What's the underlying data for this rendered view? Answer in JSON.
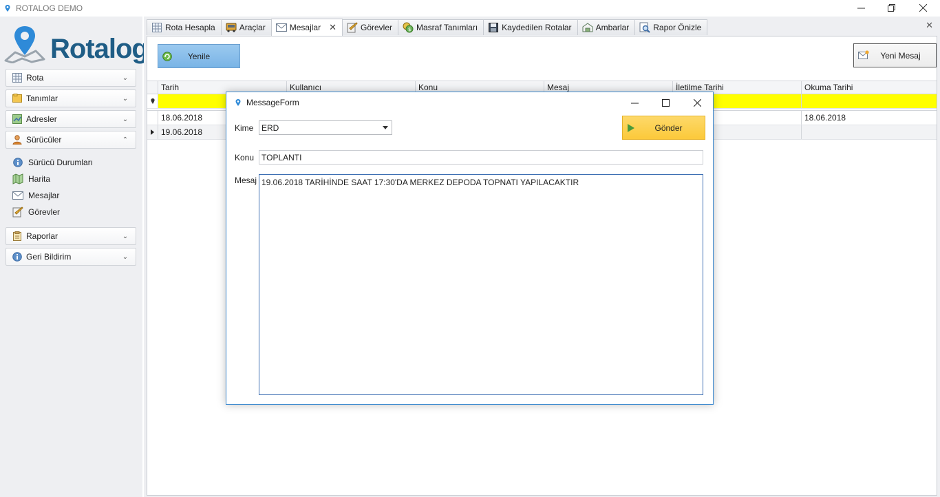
{
  "window": {
    "title": "ROTALOG DEMO",
    "controls": [
      "minimize",
      "restore",
      "close"
    ]
  },
  "sidebar": {
    "logo_text": "Rotalog",
    "groups": [
      {
        "label": "Rota",
        "icon": "grid-icon",
        "expanded": false
      },
      {
        "label": "Tanımlar",
        "icon": "folder-icon",
        "expanded": false
      },
      {
        "label": "Adresler",
        "icon": "map-icon",
        "expanded": false
      },
      {
        "label": "Sürücüler",
        "icon": "driver-icon",
        "expanded": true
      },
      {
        "label": "Raporlar",
        "icon": "clipboard-icon",
        "expanded": false
      },
      {
        "label": "Geri Bildirim",
        "icon": "info-icon",
        "expanded": false
      }
    ],
    "driver_items": [
      {
        "label": "Sürücü Durumları",
        "icon": "info-icon"
      },
      {
        "label": "Harita",
        "icon": "map-icon"
      },
      {
        "label": "Mesajlar",
        "icon": "envelope-icon"
      },
      {
        "label": "Görevler",
        "icon": "task-icon"
      }
    ]
  },
  "tabs": [
    {
      "label": "Rota Hesapla",
      "icon": "grid-icon"
    },
    {
      "label": "Araçlar",
      "icon": "truck-icon"
    },
    {
      "label": "Mesajlar",
      "icon": "envelope-icon",
      "active": true
    },
    {
      "label": "Görevler",
      "icon": "task-icon"
    },
    {
      "label": "Masraf Tanımları",
      "icon": "coins-icon"
    },
    {
      "label": "Kaydedilen Rotalar",
      "icon": "save-icon"
    },
    {
      "label": "Ambarlar",
      "icon": "warehouse-icon"
    },
    {
      "label": "Rapor Önizle",
      "icon": "preview-icon"
    }
  ],
  "toolbar": {
    "refresh_label": "Yenile",
    "new_message_label": "Yeni Mesaj"
  },
  "grid": {
    "columns": [
      "Tarih",
      "Kullanıcı",
      "Konu",
      "Mesaj",
      "İletilme Tarihi",
      "Okuma Tarihi"
    ],
    "rows": [
      [
        "18.06.2018",
        "",
        "",
        "",
        "",
        "18.06.2018"
      ],
      [
        "19.06.2018",
        "",
        "",
        "",
        "",
        ""
      ]
    ]
  },
  "dialog": {
    "title": "MessageForm",
    "to_label": "Kime",
    "to_value": "ERD",
    "subject_label": "Konu",
    "subject_value": "TOPLANTI",
    "message_label": "Mesaj",
    "message_value": "19.06.2018 TARİHİNDE SAAT 17:30'DA MERKEZ DEPODA TOPNATI YAPILACAKTIR",
    "send_label": "Gönder"
  },
  "colors": {
    "accent_blue": "#1f5d86",
    "refresh_button": "#8fc1ec",
    "send_button": "#fccf4a",
    "filter_row": "#ffff00"
  }
}
